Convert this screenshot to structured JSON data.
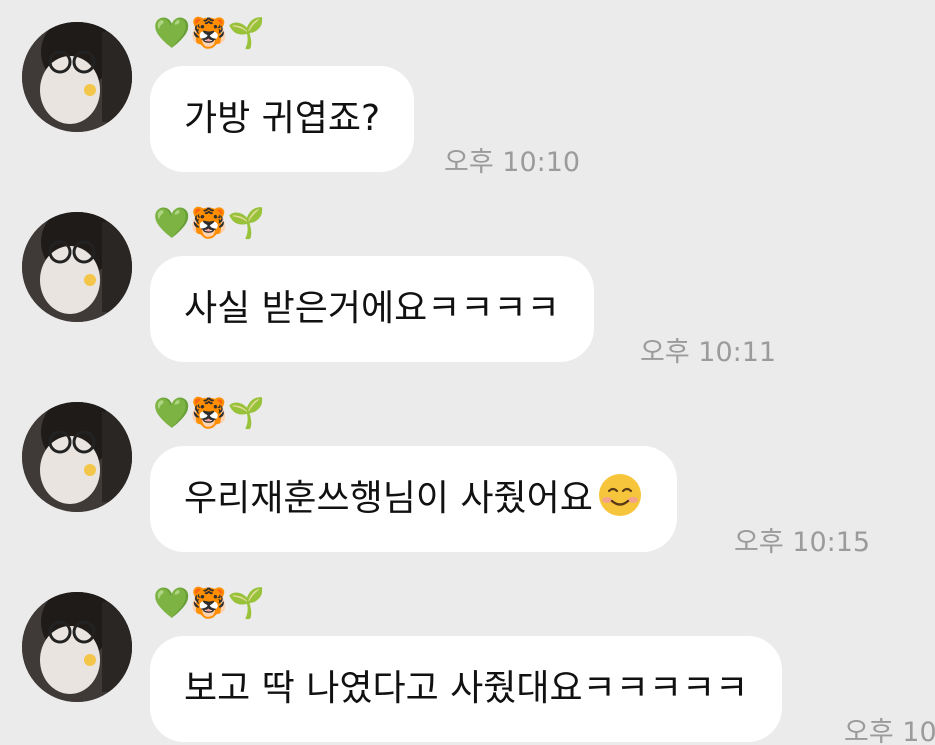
{
  "sender_name": "💚🐯🌱",
  "messages": [
    {
      "text": "가방 귀엽죠?",
      "time": "오후 10:10"
    },
    {
      "text": "사실 받은거에요ㅋㅋㅋㅋ",
      "time": "오후 10:11"
    },
    {
      "text": "우리재훈쓰행님이 사줬어요",
      "emoji": "smiling-face-icon",
      "time": "오후 10:15"
    },
    {
      "text": "보고 딱 나였다고 사줬대요ㅋㅋㅋㅋㅋ",
      "time": "오후 10:"
    }
  ],
  "colors": {
    "background": "#ebebeb",
    "bubble": "#ffffff",
    "timestamp": "#9b9b9b"
  }
}
